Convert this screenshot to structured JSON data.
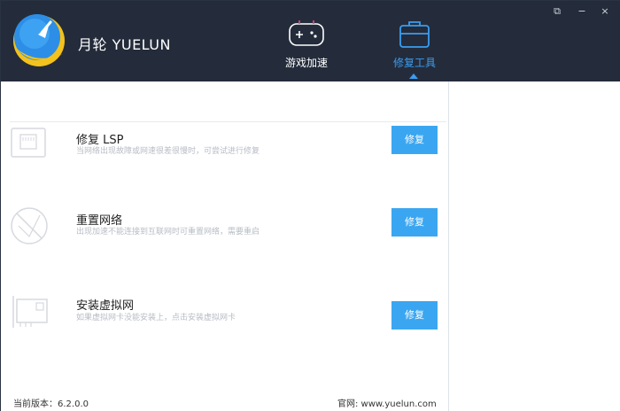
{
  "app": {
    "brand": "月轮 YUELUN",
    "colors": {
      "header_bg": "#242c3b",
      "accent": "#3a9df0",
      "button": "#3aa6f1"
    }
  },
  "nav": {
    "tabs": [
      {
        "label": "游戏加速",
        "icon": "gamepad-icon",
        "active": false
      },
      {
        "label": "修复工具",
        "icon": "toolbox-icon",
        "active": true
      }
    ]
  },
  "window_controls": {
    "skin": "⧉",
    "minimize": "−",
    "close": "×"
  },
  "tools": [
    {
      "title": "修复 LSP",
      "desc": "当网络出现故障或网速很差很慢时，可尝试进行修复",
      "button": "修复",
      "icon": "network-port-icon"
    },
    {
      "title": "重置网络",
      "desc": "出现加速不能连接到互联网时可重置网络，需要重启",
      "button": "修复",
      "icon": "reset-network-icon"
    },
    {
      "title": "安装虚拟网",
      "desc": "如果虚拟网卡没能安装上，点击安装虚拟网卡",
      "button": "修复",
      "icon": "virtual-network-card-icon"
    }
  ],
  "footer": {
    "version": "当前版本：6.2.0.0",
    "website": "官网: www.yuelun.com"
  }
}
